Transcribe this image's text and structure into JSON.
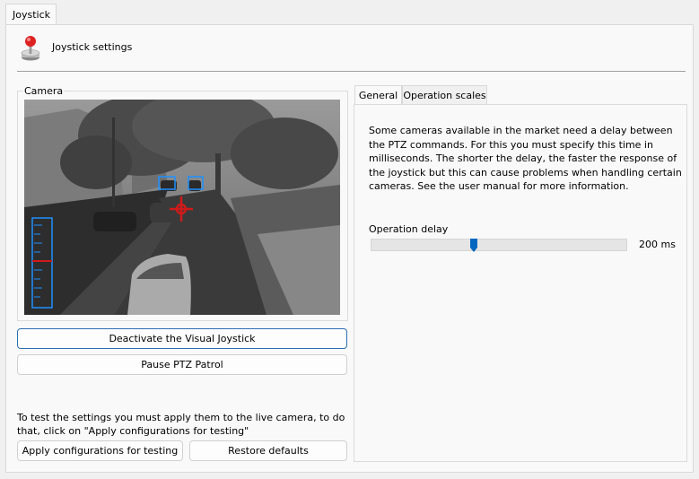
{
  "window": {
    "tab_label": "Joystick"
  },
  "header": {
    "title": "Joystick settings",
    "icon": "joystick-icon"
  },
  "camera": {
    "group_label": "Camera"
  },
  "buttons": {
    "deactivate": "Deactivate the Visual Joystick",
    "pause": "Pause PTZ Patrol",
    "apply": "Apply configurations for testing",
    "restore": "Restore defaults"
  },
  "hint": "To test the settings you must apply them to the live camera, to do that, click on \"Apply configurations for testing\"",
  "tabs": [
    {
      "label": "General",
      "active": true
    },
    {
      "label": "Operation scales",
      "active": false
    }
  ],
  "general": {
    "description": "Some cameras available in the market need a delay between the PTZ commands. For this you must specify this time in milliseconds. The shorter the delay, the faster the response of the joystick but this can cause problems when handling certain cameras. See the user manual for more information.",
    "delay_label": "Operation delay",
    "delay_value": "200 ms",
    "delay_fraction": 0.4
  },
  "colors": {
    "accent": "#0067c0",
    "overlay_blue": "#1e90ff",
    "overlay_red": "#d11a1a"
  }
}
